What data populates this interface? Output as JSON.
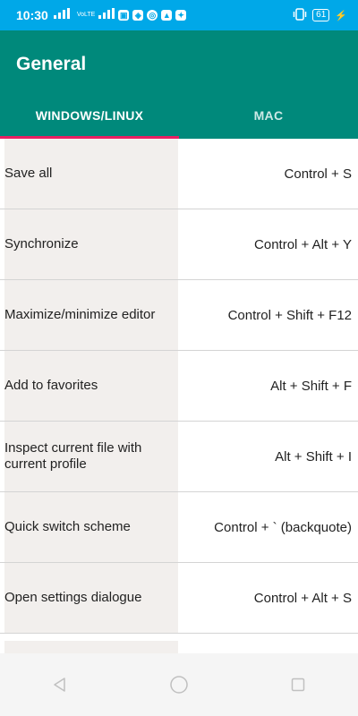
{
  "status_bar": {
    "time": "10:30",
    "battery": "61",
    "network_label": "VoLTE"
  },
  "app_bar": {
    "title": "General"
  },
  "tabs": [
    {
      "label": "WINDOWS/LINUX",
      "active": true
    },
    {
      "label": "MAC",
      "active": false
    }
  ],
  "shortcuts": [
    {
      "command": "Save all",
      "keys": "Control + S"
    },
    {
      "command": "Synchronize",
      "keys": "Control + Alt + Y"
    },
    {
      "command": "Maximize/minimize editor",
      "keys": "Control + Shift + F12"
    },
    {
      "command": "Add to favorites",
      "keys": "Alt + Shift + F"
    },
    {
      "command": "Inspect current file with current profile",
      "keys": "Alt + Shift + I"
    },
    {
      "command": "Quick switch scheme",
      "keys": "Control + ` (backquote)"
    },
    {
      "command": "Open settings dialogue",
      "keys": "Control + Alt + S"
    }
  ],
  "colors": {
    "status_bar": "#00a8e8",
    "app_bar": "#00897b",
    "tab_indicator": "#e91e63",
    "command_cell": "#f2efed"
  },
  "icons": {
    "nav_back": "back-triangle-icon",
    "nav_home": "home-circle-icon",
    "nav_recents": "recents-square-icon"
  }
}
